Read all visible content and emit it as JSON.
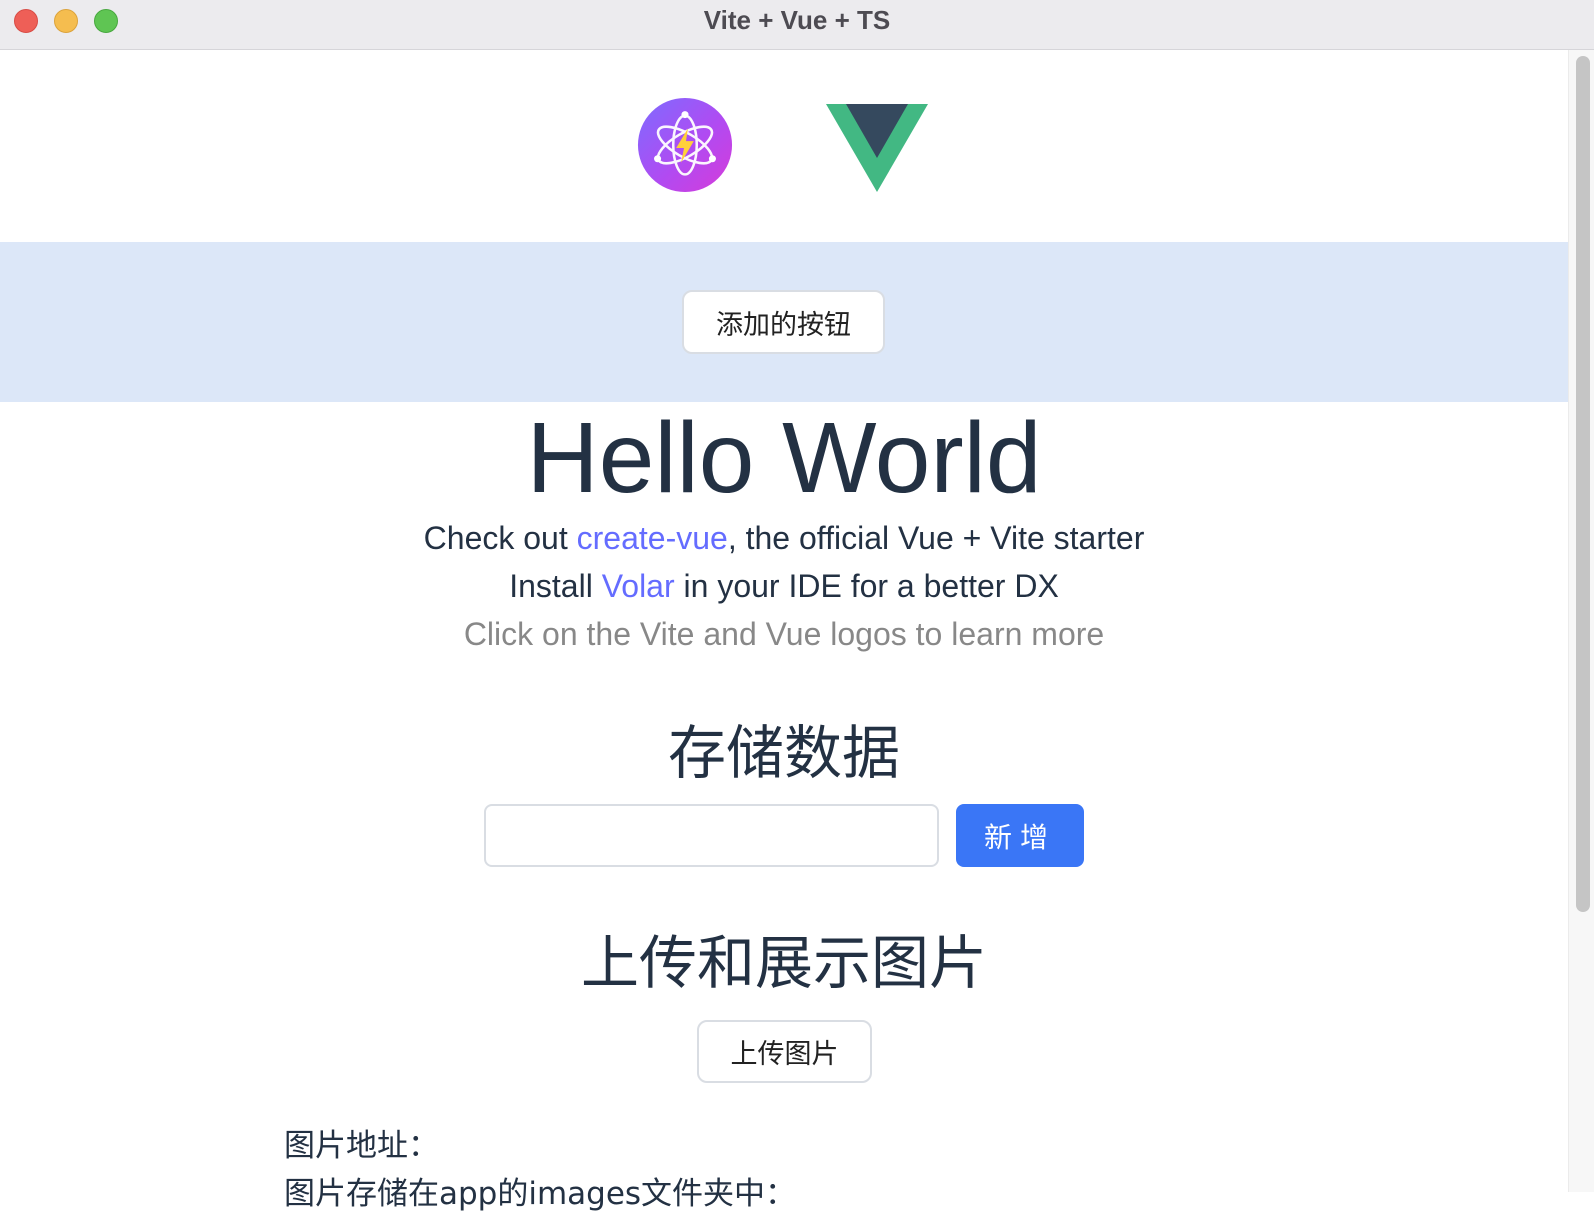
{
  "window": {
    "title": "Vite + Vue + TS"
  },
  "colors": {
    "banner_bg": "#dce7f8",
    "link": "#646cff",
    "primary_button": "#3a76f6",
    "heading": "#233143",
    "muted": "#888888"
  },
  "logos": {
    "electron": "electron-vite-logo",
    "vue": "vue-logo"
  },
  "banner": {
    "button_label": "添加的按钮"
  },
  "hero": {
    "title": "Hello World",
    "line1_prefix": "Check out ",
    "line1_link": "create-vue",
    "line1_suffix": ", the official Vue + Vite starter",
    "line2_prefix": "Install ",
    "line2_link": "Volar",
    "line2_suffix": " in your IDE for a better DX",
    "line3": "Click on the Vite and Vue logos to learn more"
  },
  "storage": {
    "title": "存储数据",
    "input_value": "",
    "add_label": "新增"
  },
  "images": {
    "title": "上传和展示图片",
    "upload_label": "上传图片",
    "address_label": "图片地址：",
    "folder_label": "图片存储在app的images文件夹中："
  }
}
